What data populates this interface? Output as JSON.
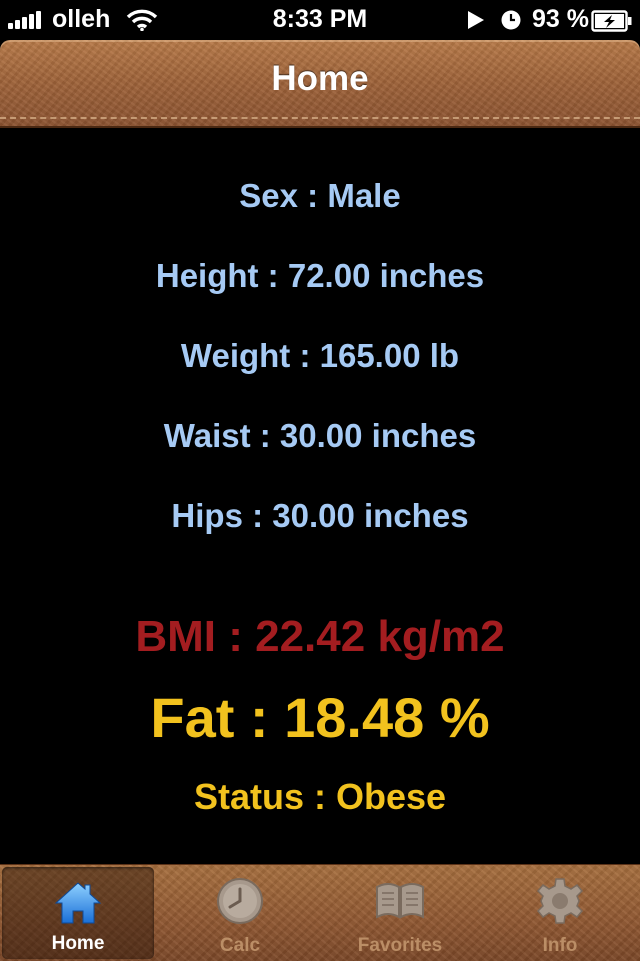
{
  "status_bar": {
    "carrier": "olleh",
    "time": "8:33 PM",
    "battery_percent": "93 %"
  },
  "nav": {
    "title": "Home"
  },
  "profile": {
    "sex": "Sex : Male",
    "height": "Height : 72.00 inches",
    "weight": "Weight : 165.00 lb",
    "waist": "Waist : 30.00 inches",
    "hips": "Hips : 30.00 inches"
  },
  "results": {
    "bmi": "BMI : 22.42 kg/m2",
    "fat": "Fat : 18.48 %",
    "status": "Status : Obese"
  },
  "colors": {
    "info_text": "#a6caf4",
    "bmi_text": "#a31d20",
    "fat_text": "#f2c21e",
    "leather": "#a0643a"
  },
  "tabs": [
    {
      "label": "Home",
      "icon": "home-icon",
      "selected": true
    },
    {
      "label": "Calc",
      "icon": "clock-icon",
      "selected": false
    },
    {
      "label": "Favorites",
      "icon": "book-icon",
      "selected": false
    },
    {
      "label": "Info",
      "icon": "gear-icon",
      "selected": false
    }
  ]
}
